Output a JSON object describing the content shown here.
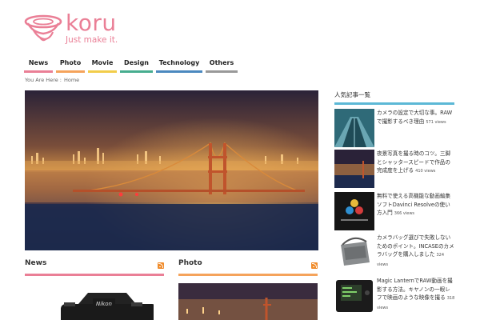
{
  "site": {
    "logo_text": "koru",
    "tagline": "Just make it.",
    "brand_color": "#ea7f96"
  },
  "nav": {
    "items": [
      {
        "label": "News",
        "color": "#ea7f96"
      },
      {
        "label": "Photo",
        "color": "#f5a35b"
      },
      {
        "label": "Movie",
        "color": "#f2cd4a"
      },
      {
        "label": "Design",
        "color": "#47ad8f"
      },
      {
        "label": "Technology",
        "color": "#4b89bf"
      },
      {
        "label": "Others",
        "color": "#999999"
      }
    ]
  },
  "breadcrumb": {
    "prefix": "You Are Here :",
    "home": "Home"
  },
  "categories": [
    {
      "title": "News",
      "color": "#ea7f96",
      "icon": "rss-icon"
    },
    {
      "title": "Photo",
      "color": "#f5a35b",
      "icon": "rss-icon"
    }
  ],
  "sidebar": {
    "title": "人気記事一覧",
    "accent": "#5cb8d6",
    "items": [
      {
        "text": "カメラの設定で大切な事。RAWで撮影するべき理由",
        "views": "571 views"
      },
      {
        "text": "夜景写真を撮る時のコツ。三脚とシャッタースピードで作品の完成度を上げる",
        "views": "410 views"
      },
      {
        "text": "無料で使える高機能な動画編集ソフトDavinci Resolveの使い方入門",
        "views": "366 views"
      },
      {
        "text": "カメラバッグ選びで失敗しないためのポイント。INCASEのカメラバッグを購入しました",
        "views": "324 views"
      },
      {
        "text": "Magic LanternでRAW動画を撮影する方法。キヤノンの一眼レフで映画のような映像を撮る",
        "views": "318 views"
      }
    ]
  }
}
